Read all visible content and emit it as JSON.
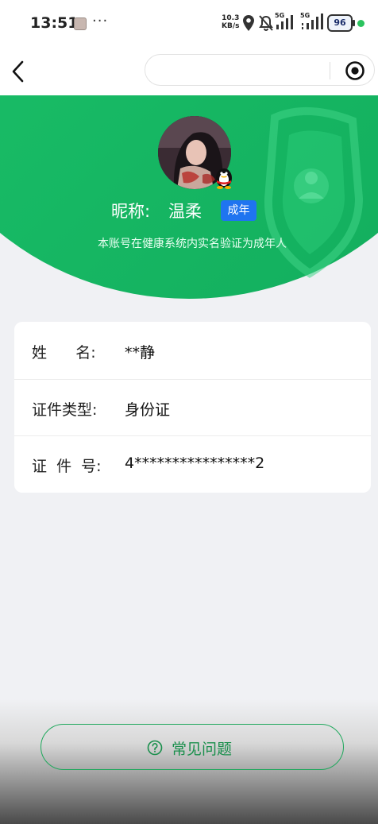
{
  "status_bar": {
    "time": "13:51",
    "more": "···",
    "net_speed_value": "10.3",
    "net_speed_unit": "KB/s",
    "signal1_label": "5G",
    "signal2_label": "5G",
    "battery": "96"
  },
  "profile": {
    "nickname_label": "昵称:",
    "nickname": "温柔",
    "age_badge": "成年",
    "verify_text": "本账号在健康系统内实名验证为成年人"
  },
  "info": {
    "rows": [
      {
        "label": "姓      名:",
        "value": "**静"
      },
      {
        "label": "证件类型:",
        "value": "身份证"
      },
      {
        "label": "证  件  号:",
        "value": "4****************2"
      }
    ]
  },
  "faq": {
    "label": "常见问题"
  },
  "colors": {
    "brand_green": "#16b763",
    "badge_blue": "#1f74f0",
    "faq_green": "#1a8f4c"
  },
  "icons": {
    "back": "chevron-left-icon",
    "capsule_target": "target-icon",
    "location": "location-pin-icon",
    "mute": "bell-off-icon",
    "qq": "qq-penguin-icon",
    "faq": "question-circle-icon"
  }
}
